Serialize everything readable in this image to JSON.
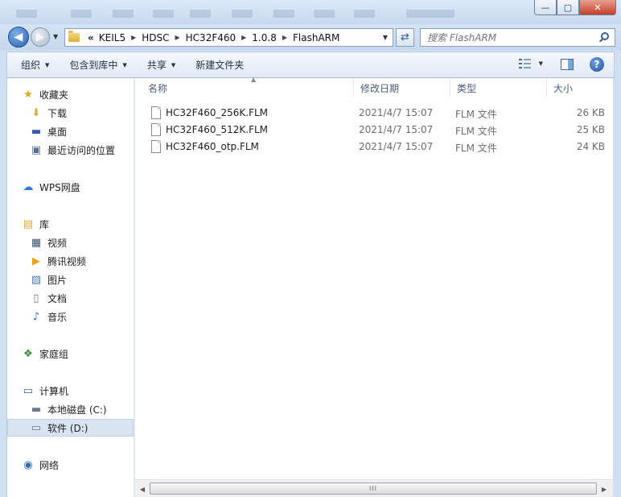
{
  "window": {
    "buttons": {
      "minimize": "—",
      "maximize": "▢",
      "close": "✕"
    }
  },
  "address": {
    "chevron": "«",
    "crumbs": [
      "KEIL5",
      "HDSC",
      "HC32F460",
      "1.0.8",
      "FlashARM"
    ],
    "search_placeholder": "搜索 FlashARM"
  },
  "toolbar": {
    "organize": "组织",
    "include_in_library": "包含到库中",
    "share": "共享",
    "new_folder": "新建文件夹"
  },
  "nav": {
    "favorites": "收藏夹",
    "downloads": "下载",
    "desktop": "桌面",
    "recent": "最近访问的位置",
    "wps": "WPS网盘",
    "libraries": "库",
    "videos": "视频",
    "tencent_video": "腾讯视频",
    "pictures": "图片",
    "documents": "文档",
    "music": "音乐",
    "homegroup": "家庭组",
    "computer": "计算机",
    "local_disk_c": "本地磁盘 (C:)",
    "software_d": "软件 (D:)",
    "network": "网络"
  },
  "columns": {
    "name": "名称",
    "modified": "修改日期",
    "type": "类型",
    "size": "大小"
  },
  "files": [
    {
      "name": "HC32F460_256K.FLM",
      "modified": "2021/4/7 15:07",
      "type": "FLM 文件",
      "size": "26 KB"
    },
    {
      "name": "HC32F460_512K.FLM",
      "modified": "2021/4/7 15:07",
      "type": "FLM 文件",
      "size": "25 KB"
    },
    {
      "name": "HC32F460_otp.FLM",
      "modified": "2021/4/7 15:07",
      "type": "FLM 文件",
      "size": "24 KB"
    }
  ],
  "scrollbar": {
    "grip": "III"
  }
}
